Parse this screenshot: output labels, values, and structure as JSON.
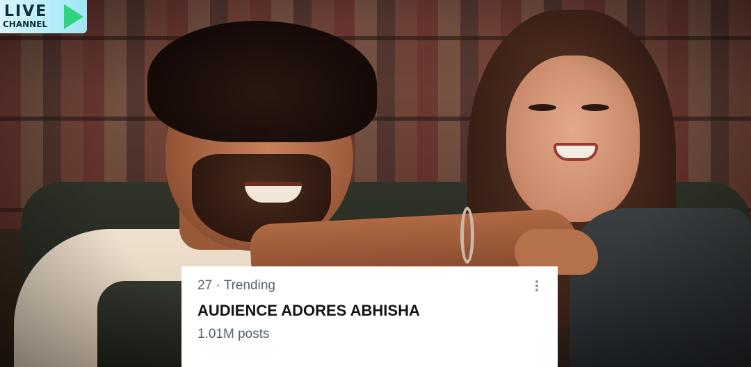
{
  "channel_logo": {
    "word": "LIVE",
    "sub": "CHANNEL"
  },
  "trend": {
    "rank": "27",
    "separator": " · ",
    "category": "Trending",
    "title": "AUDIENCE ADORES ABHISHA",
    "post_count": "1.01M posts",
    "menu_icon": "more-vertical-icon"
  }
}
